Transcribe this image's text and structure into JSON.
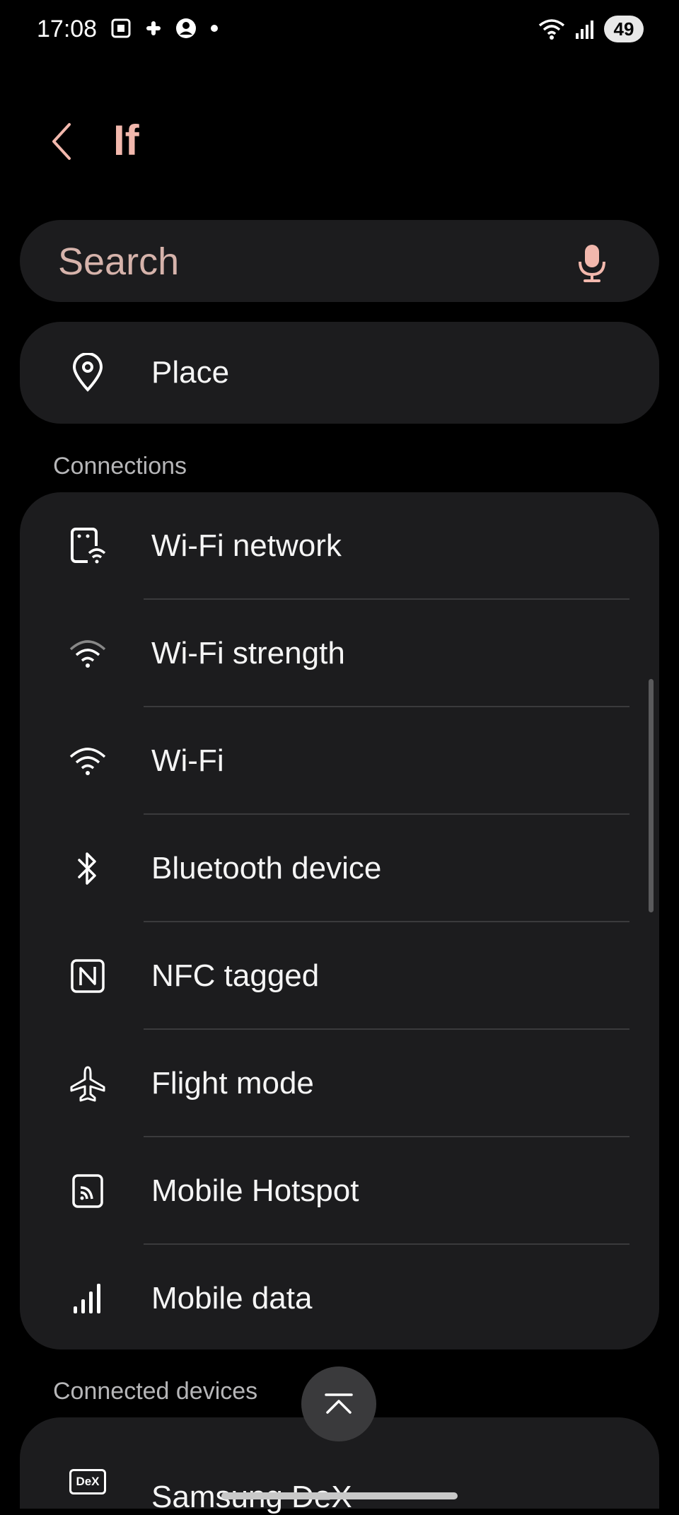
{
  "status": {
    "time": "17:08",
    "battery": "49"
  },
  "header": {
    "title": "If"
  },
  "search": {
    "placeholder": "Search"
  },
  "place_item": {
    "label": "Place",
    "icon": "location-pin-icon"
  },
  "connections": {
    "title": "Connections",
    "items": [
      {
        "label": "Wi-Fi network",
        "icon": "wifi-network-icon"
      },
      {
        "label": "Wi-Fi strength",
        "icon": "wifi-strength-icon"
      },
      {
        "label": "Wi-Fi",
        "icon": "wifi-icon"
      },
      {
        "label": "Bluetooth device",
        "icon": "bluetooth-icon"
      },
      {
        "label": "NFC tagged",
        "icon": "nfc-icon"
      },
      {
        "label": "Flight mode",
        "icon": "airplane-icon"
      },
      {
        "label": "Mobile Hotspot",
        "icon": "hotspot-icon"
      },
      {
        "label": "Mobile data",
        "icon": "signal-bars-icon"
      }
    ]
  },
  "connected_devices": {
    "title": "Connected devices",
    "items": [
      {
        "label": "Samsung DeX",
        "icon": "dex-icon",
        "icon_text": "DeX"
      }
    ]
  },
  "colors": {
    "accent": "#f2b8ad",
    "card_bg": "#1c1c1e",
    "background": "#000000"
  }
}
